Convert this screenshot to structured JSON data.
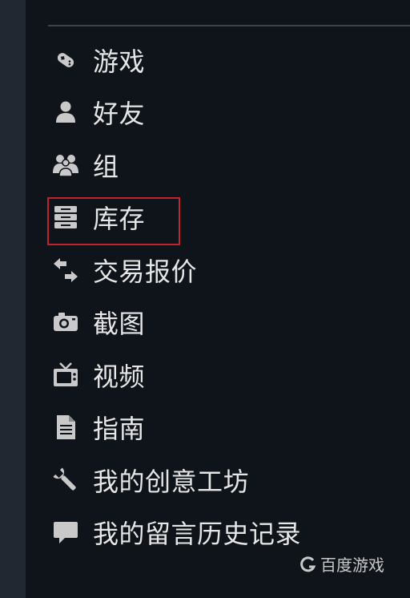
{
  "menu": {
    "items": [
      {
        "id": "games",
        "label": "游戏",
        "icon": "controller-icon"
      },
      {
        "id": "friends",
        "label": "好友",
        "icon": "user-icon"
      },
      {
        "id": "groups",
        "label": "组",
        "icon": "group-icon"
      },
      {
        "id": "inventory",
        "label": "库存",
        "icon": "inventory-icon"
      },
      {
        "id": "trade-offers",
        "label": "交易报价",
        "icon": "trade-arrows-icon"
      },
      {
        "id": "screenshots",
        "label": "截图",
        "icon": "camera-icon"
      },
      {
        "id": "videos",
        "label": "视频",
        "icon": "tv-icon"
      },
      {
        "id": "guides",
        "label": "指南",
        "icon": "document-icon"
      },
      {
        "id": "workshop",
        "label": "我的创意工坊",
        "icon": "wrench-icon"
      },
      {
        "id": "comment-history",
        "label": "我的留言历史记录",
        "icon": "speech-bubble-icon"
      }
    ],
    "highlighted": "inventory"
  },
  "watermark": {
    "text": "百度游戏",
    "icon": "baidu-logo-icon"
  },
  "colors": {
    "panel_bg": "#0f141a",
    "text": "#e6e6e6",
    "icon": "#c9c9c9",
    "highlight_border": "#c0232b"
  }
}
